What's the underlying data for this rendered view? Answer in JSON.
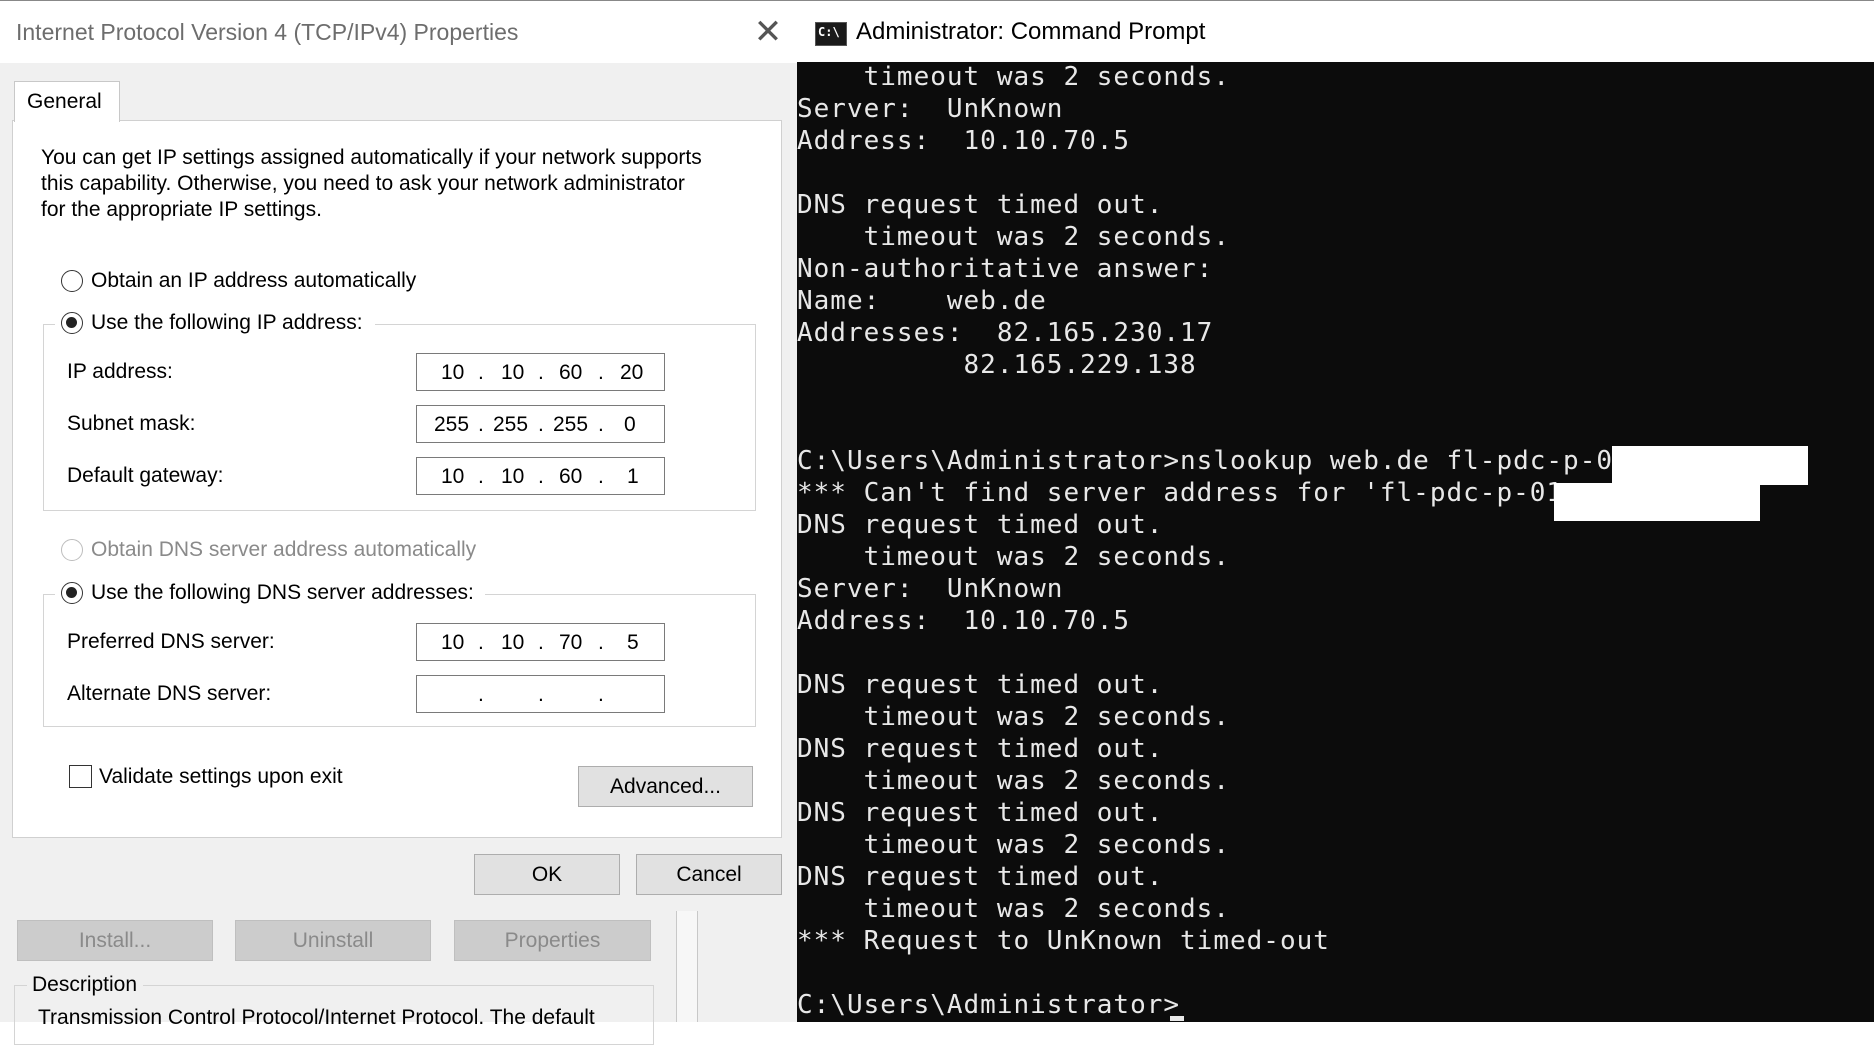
{
  "dialog": {
    "title": "Internet Protocol Version 4 (TCP/IPv4) Properties",
    "close_glyph": "✕",
    "tab": "General",
    "intro_lines": [
      "You can get IP settings assigned automatically if your network supports",
      "this capability. Otherwise, you need to ask your network administrator",
      "for the appropriate IP settings."
    ],
    "radio_ip_auto": "Obtain an IP address automatically",
    "radio_ip_manual": "Use the following IP address:",
    "ip_address_label": "IP address:",
    "ip_address": [
      "10",
      "10",
      "60",
      "20"
    ],
    "subnet_label": "Subnet mask:",
    "subnet": [
      "255",
      "255",
      "255",
      "0"
    ],
    "gateway_label": "Default gateway:",
    "gateway": [
      "10",
      "10",
      "60",
      "1"
    ],
    "radio_dns_auto": "Obtain DNS server address automatically",
    "radio_dns_manual": "Use the following DNS server addresses:",
    "pref_dns_label": "Preferred DNS server:",
    "pref_dns": [
      "10",
      "10",
      "70",
      "5"
    ],
    "alt_dns_label": "Alternate DNS server:",
    "alt_dns": [
      "",
      "",
      "",
      ""
    ],
    "dot": ".",
    "validate_label": "Validate settings upon exit",
    "advanced_button": "Advanced...",
    "ok_button": "OK",
    "cancel_button": "Cancel",
    "selected_ip_option": "manual",
    "selected_dns_option": "manual",
    "validate_checked": false
  },
  "background_window": {
    "install_button": "Install...",
    "uninstall_button": "Uninstall",
    "properties_button": "Properties",
    "description_label": "Description",
    "description_text": "Transmission Control Protocol/Internet Protocol. The default"
  },
  "console": {
    "title": "Administrator: Command Prompt",
    "icon_text": "C:\\",
    "lines": [
      "    timeout was 2 seconds.",
      "Server:  UnKnown",
      "Address:  10.10.70.5",
      "",
      "DNS request timed out.",
      "    timeout was 2 seconds.",
      "Non-authoritative answer:",
      "Name:    web.de",
      "Addresses:  82.165.230.17",
      "          82.165.229.138",
      "",
      "",
      "C:\\Users\\Administrator>nslookup web.de fl-pdc-p-01.",
      "*** Can't find server address for 'fl-pdc-p-01.",
      "DNS request timed out.",
      "    timeout was 2 seconds.",
      "Server:  UnKnown",
      "Address:  10.10.70.5",
      "",
      "DNS request timed out.",
      "    timeout was 2 seconds.",
      "DNS request timed out.",
      "    timeout was 2 seconds.",
      "DNS request timed out.",
      "    timeout was 2 seconds.",
      "DNS request timed out.",
      "    timeout was 2 seconds.",
      "*** Request to UnKnown timed-out",
      "",
      "C:\\Users\\Administrator>"
    ]
  }
}
